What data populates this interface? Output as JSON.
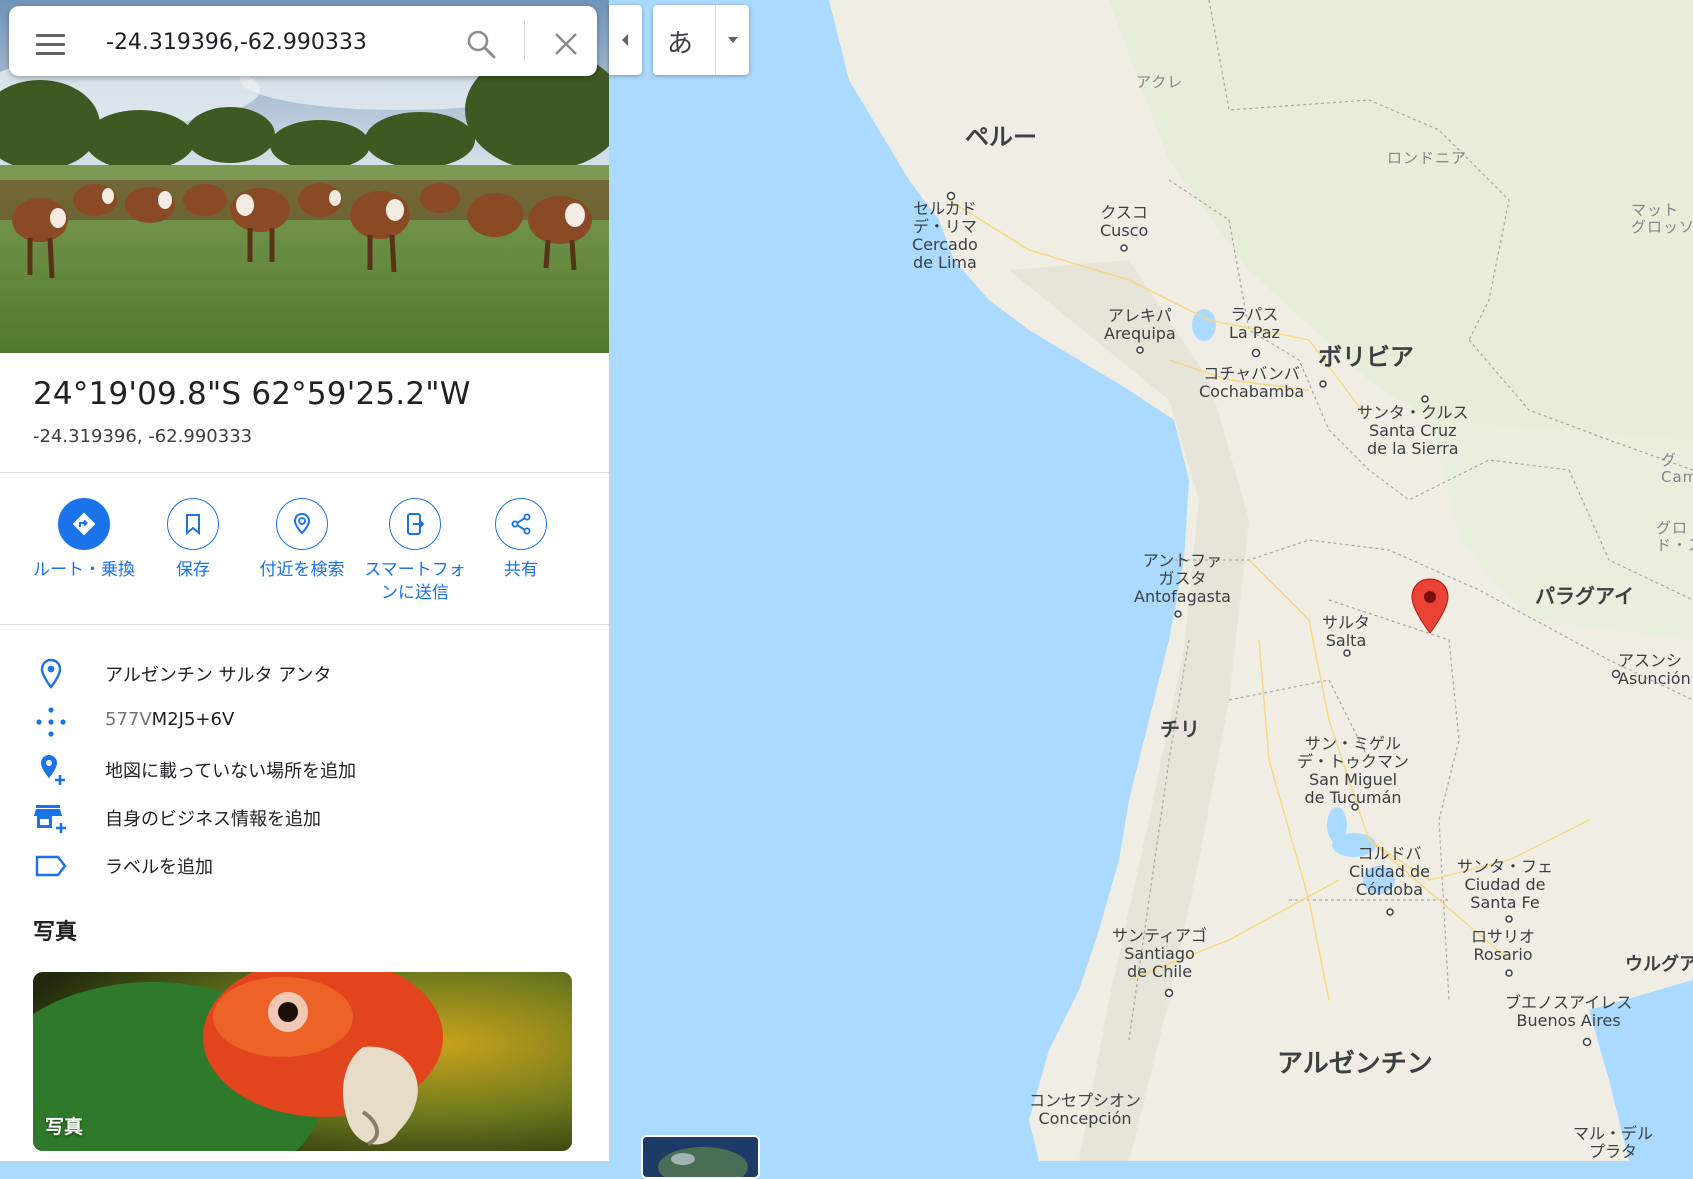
{
  "search": {
    "value": "-24.319396,-62.990333"
  },
  "place": {
    "title": "24°19'09.8\"S 62°59'25.2\"W",
    "subtitle": "-24.319396, -62.990333"
  },
  "actions": [
    {
      "label": "ルート・乗換",
      "icon": "directions-icon"
    },
    {
      "label": "保存",
      "icon": "bookmark-icon"
    },
    {
      "label": "付近を検索",
      "icon": "nearby-search-icon"
    },
    {
      "label": "スマートフォンに送信",
      "icon": "send-to-phone-icon"
    },
    {
      "label": "共有",
      "icon": "share-icon"
    }
  ],
  "info": {
    "address": "アルゼンチン サルタ アンタ",
    "pluscode_prefix": "577V",
    "pluscode_main": "M2J5+6V",
    "add_missing_place": "地図に載っていない場所を追加",
    "add_business": "自身のビジネス情報を追加",
    "add_label": "ラベルを追加"
  },
  "photos": {
    "heading": "写真",
    "card_label": "写真"
  },
  "ime": {
    "char": "あ"
  },
  "map": {
    "accent": "#1a73e8",
    "pin_color": "#ea4335",
    "water_color": "#aadaff",
    "land_color": "#f0ede5",
    "countries": [
      "ペルー",
      "ボリビア",
      "パラグアイ",
      "チリ",
      "アルゼンチン",
      "ウルグア"
    ],
    "regions": [
      "アクレ",
      "ロンドニア",
      "マット\nグロッソ",
      "グ\nCam",
      "グロ\nド・ス"
    ],
    "cities": [
      "セルカド\nデ・リマ\nCercado\nde Lima",
      "クスコ\nCusco",
      "アレキパ\nArequipa",
      "ラパス\nLa Paz",
      "コチャバンバ\nCochabamba",
      "サンタ・クルス\nSanta Cruz\nde la Sierra",
      "アントファ\nガスタ\nAntofagasta",
      "サルタ\nSalta",
      "アスンシ\nAsunción",
      "サン・ミゲル\nデ・トゥクマン\nSan Miguel\nde Tucumán",
      "コルドバ\nCiudad de\nCórdoba",
      "サンタ・フェ\nCiudad de\nSanta Fe",
      "ロサリオ\nRosario",
      "サンティアゴ\nSantiago\nde Chile",
      "ブエノスアイレス\nBuenos Aires",
      "コンセプシオン\nConcepción",
      "マル・デル\nプラタ"
    ]
  }
}
